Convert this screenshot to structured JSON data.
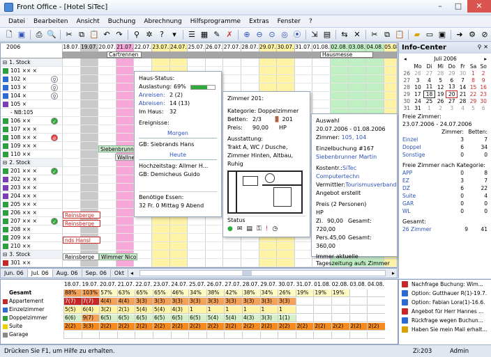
{
  "window": {
    "title": "Front Office - [Hotel SiTec]"
  },
  "menu": [
    "Datei",
    "Bearbeiten",
    "Ansicht",
    "Buchung",
    "Abrechnung",
    "Hilfsprogramme",
    "Extras",
    "Fenster",
    "?"
  ],
  "planner": {
    "year": "2006",
    "days": [
      "18.07.",
      "19.07.",
      "20.07.",
      "21.07.",
      "22.07.",
      "23.07.",
      "24.07.",
      "25.07.",
      "26.07.",
      "27.07.",
      "28.07.",
      "29.07.",
      "30.07.",
      "31.07.",
      "01.08.",
      "02.08.",
      "03.08.",
      "04.08.",
      "05.08."
    ],
    "events": [
      {
        "label": "Cartrennen"
      },
      {
        "label": "Hausmesse"
      }
    ],
    "rows": [
      {
        "label": "1. Stock",
        "floor": true
      },
      {
        "label": "101 ×× ×"
      },
      {
        "label": "102 ×"
      },
      {
        "label": "103 ×"
      },
      {
        "label": "104 ×"
      },
      {
        "label": "105 ×"
      },
      {
        "label": "- NB:105"
      },
      {
        "label": "106 ××"
      },
      {
        "label": "107 ×× ×"
      },
      {
        "label": "108 ×× ×"
      },
      {
        "label": "109 ×× ×"
      },
      {
        "label": "110 ××"
      },
      {
        "label": "2. Stock",
        "floor": true
      },
      {
        "label": "201 ×× ×"
      },
      {
        "label": "202 ×× ×"
      },
      {
        "label": "203 ×× ×"
      },
      {
        "label": "204 ×× ×"
      },
      {
        "label": "205 ×× ×"
      },
      {
        "label": "206 ×× ×"
      },
      {
        "label": "207 ×× ×"
      },
      {
        "label": "208 ××"
      },
      {
        "label": "209 ××"
      },
      {
        "label": "210 ××"
      },
      {
        "label": "3. Stock",
        "floor": true
      },
      {
        "label": "301 ××"
      }
    ],
    "bookings": [
      "Siebenbrunner",
      "Wallner",
      "Reinsberge",
      "Reinsberge",
      "nds Hansl",
      "Reinsberge",
      "Wimmer Nicol"
    ]
  },
  "monthtabs": [
    "Jun. 06",
    "Jul. 06",
    "Aug. 06",
    "Sep. 06",
    "Okt"
  ],
  "haus_status": {
    "title": "Haus-Status:",
    "auslastung_label": "Auslastung:",
    "auslastung": "69%",
    "auslastung_level": 0.69,
    "anreisen_label": "Anreisen:",
    "anreisen": "2 (2)",
    "abreisen_label": "Abreisen:",
    "abreisen": "14 (13)",
    "im_haus_label": "Im Haus:",
    "im_haus": "32",
    "ereignisse": "Ereignisse:",
    "morgen": "Morgen",
    "gb1": "GB: Siebrands Hans",
    "heute": "Heute",
    "hochzeit": "Hochzeitstag: Allmer H...",
    "gb2": "GB: Demicheus Guido",
    "essen_label": "Benötige Essen:",
    "essen": "32 Fr. 0 Mittag 9 Abend"
  },
  "zimmer": {
    "title": "Zimmer 201:",
    "kategorie": "Kategorie: Doppelzimmer",
    "betten": "Betten:",
    "betten_val": "2/3",
    "nr": "201",
    "preis": "Preis:",
    "preis_val": "90,00",
    "hp": "HP",
    "ausstattung": "Ausstattung:",
    "ausstattung_text": "Trakt A, WC / Dusche, Zimmer Hinten, Altbau, Ruhig",
    "status": "Status"
  },
  "auswahl": {
    "title": "Auswahl",
    "dates": "20.07.2006 - 01.08.2006",
    "zimmer_label": "Zimmer:",
    "zimmer": "105, 104",
    "einzel": "Einzelbuchung #167",
    "gast": "Siebenbrunner Martin",
    "kostentr_label": "Kostentr.:",
    "kostentr": "SiTec Computertechn",
    "vermittler_label": "Vermittler:",
    "vermittler": "Tourismusverband",
    "angebot": "Angebot erstellt",
    "preis_title": "Preis (2 Personen)",
    "hp": "HP",
    "zi": "Zi.",
    "zi_val": "90,00",
    "gesamt1_label": "Gesamt:",
    "gesamt1": "720,00",
    "pers": "Pers.45,00",
    "gesamt2_label": "Gesamt:",
    "gesamt2": "360,00",
    "note": "Immer aktuelle Tageszeitung aufs Zimmer legen"
  },
  "info_center": {
    "title": "Info-Center",
    "month": "Juli 2006",
    "weekdays": [
      "Mo",
      "Di",
      "Mi",
      "Do",
      "Fr",
      "Sa",
      "So"
    ],
    "weeks": [
      {
        "wk": "26",
        "days": [
          "26",
          "27",
          "28",
          "29",
          "30",
          "1",
          "2"
        ]
      },
      {
        "wk": "27",
        "days": [
          "3",
          "4",
          "5",
          "6",
          "7",
          "8",
          "9"
        ]
      },
      {
        "wk": "28",
        "days": [
          "10",
          "11",
          "12",
          "13",
          "14",
          "15",
          "16"
        ]
      },
      {
        "wk": "29",
        "days": [
          "17",
          "18",
          "19",
          "20",
          "21",
          "22",
          "23"
        ]
      },
      {
        "wk": "30",
        "days": [
          "24",
          "25",
          "26",
          "27",
          "28",
          "29",
          "30"
        ]
      },
      {
        "wk": "31",
        "days": [
          "31",
          "1",
          "2",
          "3",
          "4",
          "5",
          "6"
        ]
      }
    ],
    "freie_title": "Freie Zimmer:",
    "freie_dates": "23.07.2006 - 24.07.2006",
    "col_zimmer": "Zimmer:",
    "col_betten": "Betten:",
    "freie": [
      {
        "k": "Einzel",
        "z": "3",
        "b": "7"
      },
      {
        "k": "Doppel",
        "z": "6",
        "b": "34"
      },
      {
        "k": "Sonstige",
        "z": "0",
        "b": "0"
      }
    ],
    "kat_title": "Freie Zimmer nach Kategorie:",
    "kat": [
      {
        "k": "APP",
        "z": "0",
        "b": "8"
      },
      {
        "k": "EZ",
        "z": "3",
        "b": "7"
      },
      {
        "k": "DZ",
        "z": "6",
        "b": "22"
      },
      {
        "k": "Suite",
        "z": "0",
        "b": "4"
      },
      {
        "k": "GAR",
        "z": "0",
        "b": "0"
      },
      {
        "k": "WL",
        "z": "0",
        "b": "0"
      }
    ],
    "gesamt_title": "Gesamt:",
    "gesamt": {
      "k": "26 Zimmer",
      "z": "9",
      "b": "41"
    }
  },
  "occupancy": {
    "days": [
      "18.07.",
      "19.07.",
      "20.07.",
      "21.07.",
      "22.07.",
      "23.07.",
      "24.07.",
      "25.07.",
      "26.07.",
      "27.07.",
      "28.07.",
      "29.07.",
      "30.07.",
      "31.07.",
      "01.08.",
      "02.08.",
      "03.08.",
      "04.08."
    ],
    "rows": [
      {
        "label": "Gesamt",
        "cells": [
          "88%",
          "103%",
          "57%",
          "63%",
          "65%",
          "65%",
          "46%",
          "34%",
          "38%",
          "42%",
          "38%",
          "34%",
          "26%",
          "19%",
          "19%",
          "19%",
          "",
          ""
        ]
      },
      {
        "label": "Appartement",
        "color": "#c62828",
        "cells": [
          "7(7)",
          "7(7)",
          "4(4)",
          "4(4)",
          "3(3)",
          "3(3)",
          "3(3)",
          "3(3)",
          "3(3)",
          "3(3)",
          "3(3)",
          "3(3)",
          "3(3)",
          "",
          "",
          "",
          "",
          ""
        ]
      },
      {
        "label": "Einzelzimmer",
        "color": "#2c6ad4",
        "cells": [
          "5(5)",
          "6(4)",
          "3(2)",
          "2(1)",
          "5(4)",
          "5(4)",
          "4(3)",
          "1",
          "1",
          "1",
          "1",
          "1",
          "1",
          "",
          "",
          "",
          "",
          ""
        ]
      },
      {
        "label": "Doppelzimmer",
        "color": "#2e9e3e",
        "cells": [
          "6(6)",
          "9(7)",
          "6(5)",
          "6(5)",
          "6(5)",
          "6(5)",
          "6(5)",
          "6(5)",
          "5(4)",
          "5(4)",
          "4(3)",
          "3(3)",
          "1(1)",
          "",
          "",
          "",
          "",
          ""
        ]
      },
      {
        "label": "Suite",
        "color": "#f0d000",
        "cells": [
          "2(2)",
          "3(3)",
          "2(2)",
          "2(2)",
          "2(2)",
          "2(2)",
          "2(2)",
          "2(2)",
          "2(2)",
          "2(2)",
          "2(2)",
          "2(2)",
          "2(2)",
          "2(2)",
          "2(2)",
          "2(2)",
          "2(2)",
          "2(2)"
        ]
      },
      {
        "label": "Garage",
        "color": "#888888",
        "cells": [
          "",
          "",
          "",
          "",
          "",
          "",
          "",
          "",
          "",
          "",
          "",
          "",
          "",
          "",
          "",
          "",
          "",
          ""
        ]
      }
    ]
  },
  "tasks": [
    "Nachfrage Buchung: Wim...",
    "Option: Gutthauer R(1)-19.7.",
    "Option: Fabian Lora(1)-16.6.",
    "Angebot für Herr Hannes ...",
    "Rückfrage wegen Buchun...",
    "Haben Sie mein Mail erhalt..."
  ],
  "status": {
    "help": "Drücken Sie F1, um Hilfe zu erhalten.",
    "room": "Zi:203",
    "user": "Admin"
  }
}
